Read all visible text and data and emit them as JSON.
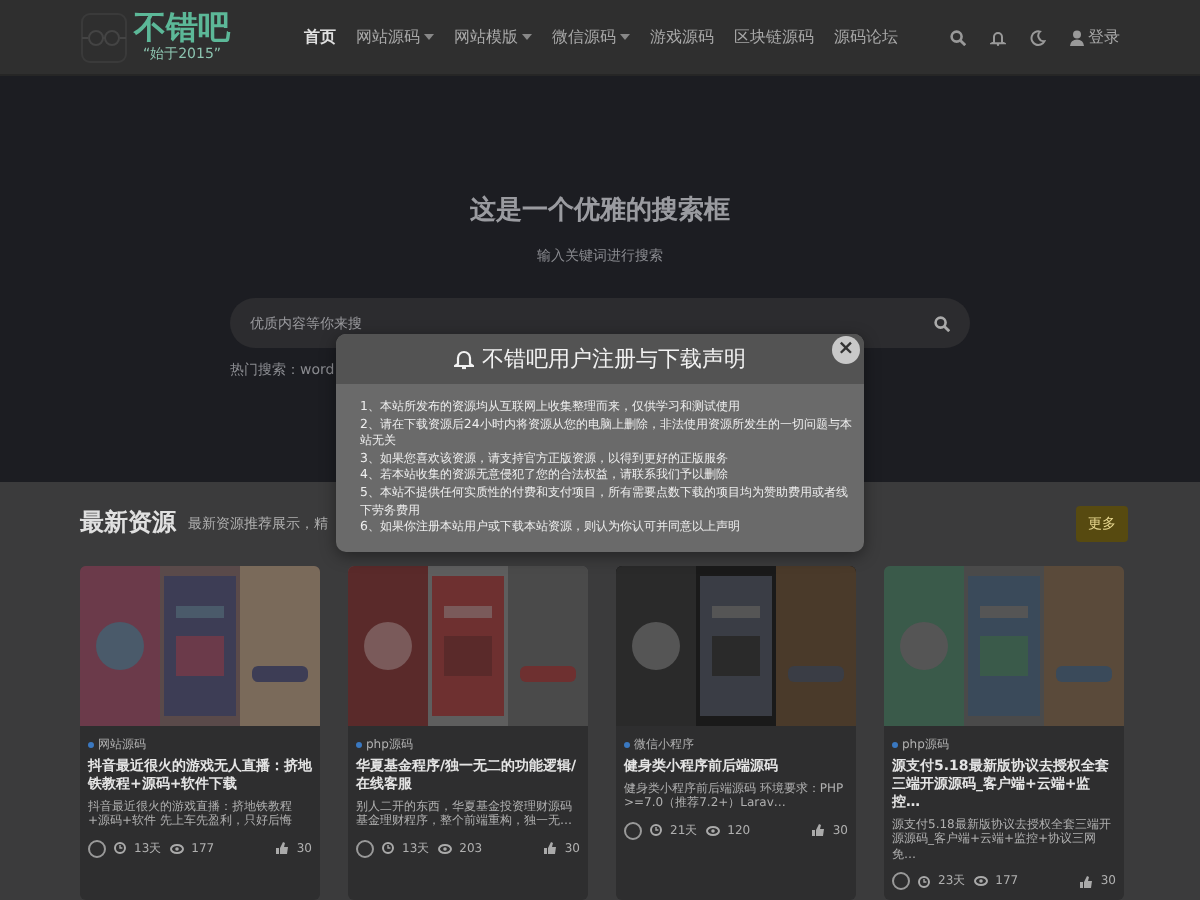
{
  "header": {
    "logo": {
      "name": "不错吧",
      "tagline": "“始于2015”"
    },
    "nav": [
      {
        "label": "首页",
        "selected": true,
        "dropdown": false
      },
      {
        "label": "网站源码",
        "selected": false,
        "dropdown": true
      },
      {
        "label": "网站模版",
        "selected": false,
        "dropdown": true
      },
      {
        "label": "微信源码",
        "selected": false,
        "dropdown": true
      },
      {
        "label": "游戏源码",
        "selected": false,
        "dropdown": false
      },
      {
        "label": "区块链源码",
        "selected": false,
        "dropdown": false
      },
      {
        "label": "源码论坛",
        "selected": false,
        "dropdown": false
      }
    ],
    "login": "登录"
  },
  "hero": {
    "title": "这是一个优雅的搜索框",
    "subtitle": "输入关键词进行搜索",
    "search": {
      "placeholder": "优质内容等你来搜"
    },
    "hot": "热门搜索：word"
  },
  "section": {
    "title": "最新资源",
    "subtitle": "最新资源推荐展示，精",
    "more": "更多"
  },
  "cards": [
    {
      "category": "网站源码",
      "title": "抖音最近很火的游戏无人直播：挤地铁教程+源码+软件下载",
      "excerpt": "抖音最近很火的游戏直播：挤地铁教程+源码+软件 先上车先盈利，只好后悔",
      "time": "13天",
      "views": "177",
      "likes": "30"
    },
    {
      "category": "php源码",
      "title": "华夏基金程序/独一无二的功能逻辑/在线客服",
      "excerpt": "别人二开的东西，华夏基金投资理财源码基金理财程序，整个前端重构，独一无…",
      "time": "13天",
      "views": "203",
      "likes": "30"
    },
    {
      "category": "微信小程序",
      "title": "健身类小程序前后端源码",
      "excerpt": "健身类小程序前后端源码 环境要求：PHP >=7.0（推荐7.2+）Larav…",
      "time": "21天",
      "views": "120",
      "likes": "30"
    },
    {
      "category": "php源码",
      "title": "源支付5.18最新版协议去授权全套三端开源源码_客户端+云端+监控…",
      "excerpt": "源支付5.18最新版协议去授权全套三端开源源码_客户端+云端+监控+协议三网免…",
      "time": "23天",
      "views": "177",
      "likes": "30"
    }
  ],
  "modal": {
    "title": "不错吧用户注册与下载声明",
    "close": "×",
    "items": [
      "1、本站所发布的资源均从互联网上收集整理而来，仅供学习和测试使用",
      "2、请在下载资源后24小时内将资源从您的电脑上删除，非法使用资源所发生的一切问题与本站无关",
      "3、如果您喜欢该资源，请支持官方正版资源，以得到更好的正版服务",
      "4、若本站收集的资源无意侵犯了您的合法权益，请联系我们予以删除",
      "5、本站不提供任何实质性的付费和支付项目，所有需要点数下载的项目均为赞助费用或者线下劳务费用",
      "6、如果你注册本站用户或下载本站资源，则认为你认可并同意以上声明"
    ]
  }
}
